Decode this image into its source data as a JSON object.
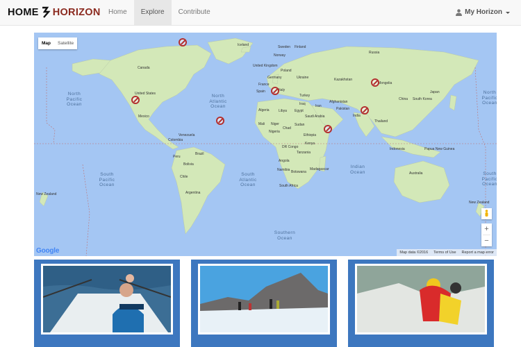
{
  "brand": {
    "home": "HOME",
    "horizon": "HORIZON"
  },
  "nav": {
    "items": [
      {
        "label": "Home",
        "active": false
      },
      {
        "label": "Explore",
        "active": true
      },
      {
        "label": "Contribute",
        "active": false
      }
    ]
  },
  "user_menu": {
    "label": "My Horizon"
  },
  "map": {
    "type_control": {
      "map": "Map",
      "satellite": "Satellite"
    },
    "zoom_in": "+",
    "zoom_out": "−",
    "google": "Google",
    "footer": {
      "data": "Map data ©2016",
      "terms": "Terms of Use",
      "report": "Report a map error"
    },
    "oceans": {
      "north_pacific_left": "North Pacific Ocean",
      "north_atlantic": "North Atlantic Ocean",
      "south_pacific": "South Pacific Ocean",
      "south_atlantic": "South Atlantic Ocean",
      "indian": "Indian Ocean",
      "north_pacific_right": "North Pacific Ocean",
      "south_pacific_right": "South Pacific Ocean",
      "southern": "Southern Ocean"
    },
    "labels": {
      "russia": "Russia",
      "sweden": "Sweden",
      "finland": "Finland",
      "iceland": "Iceland",
      "norway": "Norway",
      "united_kingdom": "United Kingdom",
      "poland": "Poland",
      "germany": "Germany",
      "ukraine": "Ukraine",
      "france": "France",
      "spain": "Spain",
      "italy": "Italy",
      "kazakhstan": "Kazakhstan",
      "mongolia": "Mongolia",
      "turkey": "Turkey",
      "china": "China",
      "japan": "Japan",
      "south_korea": "South Korea",
      "iraq": "Iraq",
      "iran": "Iran",
      "afghanistan": "Afghanistan",
      "pakistan": "Pakistan",
      "india": "India",
      "thailand": "Thailand",
      "algeria": "Algeria",
      "libya": "Libya",
      "egypt": "Egypt",
      "saudi_arabia": "Saudi Arabia",
      "mali": "Mali",
      "niger": "Niger",
      "chad": "Chad",
      "sudan": "Sudan",
      "nigeria": "Nigeria",
      "ethiopia": "Ethiopia",
      "kenya": "Kenya",
      "dr_congo": "DR Congo",
      "tanzania": "Tanzania",
      "angola": "Angola",
      "namibia": "Namibia",
      "botswana": "Botswana",
      "south_africa": "South Africa",
      "madagascar": "Madagascar",
      "indonesia": "Indonesia",
      "papua_new_guinea": "Papua New Guinea",
      "australia": "Australia",
      "new_zealand_left": "New Zealand",
      "new_zealand_right": "New Zealand",
      "canada": "Canada",
      "united_states": "United States",
      "mexico": "Mexico",
      "venezuela": "Venezuela",
      "colombia": "Colombia",
      "peru": "Peru",
      "brazil": "Brazil",
      "bolivia": "Bolivia",
      "chile": "Chile",
      "argentina": "Argentina"
    }
  },
  "colors": {
    "marker": "#b3302f",
    "card_bg": "#3d77bf",
    "brand_red": "#8b2a1f",
    "ocean": "#a4c6f3",
    "land": "#d3e8b8"
  },
  "cards": [
    {
      "image": "rowing boat crew at sea"
    },
    {
      "image": "hikers on glacier with mountains"
    },
    {
      "image": "mountaineers at summit"
    }
  ]
}
